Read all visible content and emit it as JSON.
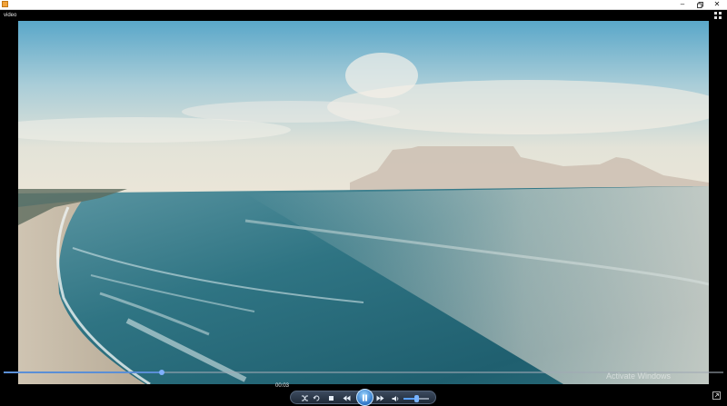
{
  "window": {
    "icon": "media-player-app-icon",
    "minimize_glyph": "–",
    "close_glyph": "✕"
  },
  "player": {
    "video_label": "video",
    "current_time": "00:03",
    "progress": 0.22,
    "volume": 0.5,
    "state": "playing"
  },
  "controls": {
    "items": [
      "shuffle-icon",
      "repeat-icon",
      "stop-icon",
      "previous-icon",
      "pause-icon",
      "next-icon",
      "volume-icon"
    ]
  },
  "watermark": {
    "text": "Activate Windows"
  },
  "colors": {
    "accent": "#2f76c7",
    "seek_fill": "#5b8fd6"
  }
}
